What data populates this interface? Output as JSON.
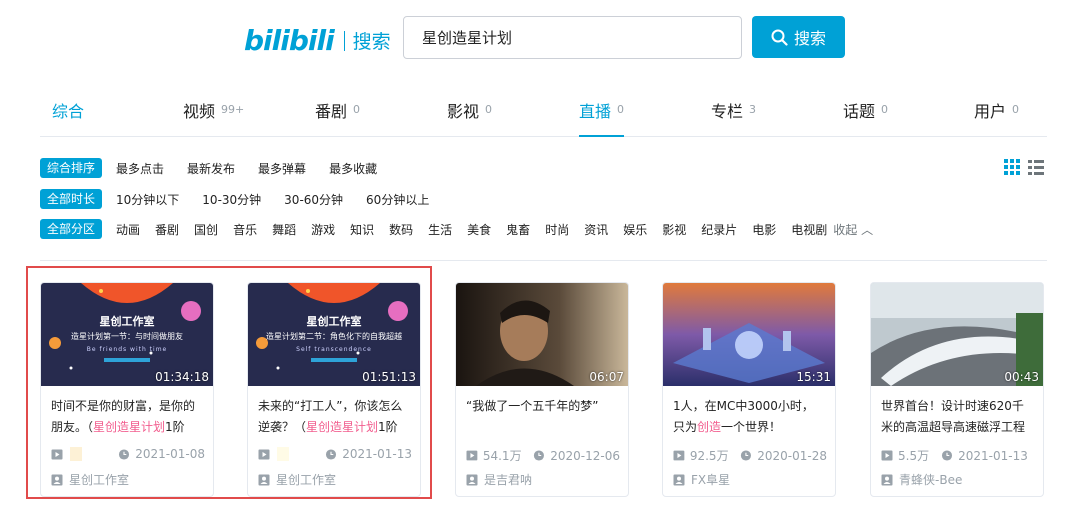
{
  "header": {
    "logo_text": "bilibili",
    "logo_sub": "搜索",
    "search_value": "星创造星计划",
    "search_button": "搜索"
  },
  "tabs": [
    {
      "label": "综合",
      "count": ""
    },
    {
      "label": "视频",
      "count": "99+"
    },
    {
      "label": "番剧",
      "count": "0"
    },
    {
      "label": "影视",
      "count": "0"
    },
    {
      "label": "直播",
      "count": "0"
    },
    {
      "label": "专栏",
      "count": "3"
    },
    {
      "label": "话题",
      "count": "0"
    },
    {
      "label": "用户",
      "count": "0"
    }
  ],
  "filters": {
    "order": {
      "badge": "综合排序",
      "options": [
        "最多点击",
        "最新发布",
        "最多弹幕",
        "最多收藏"
      ]
    },
    "duration": {
      "badge": "全部时长",
      "options": [
        "10分钟以下",
        "10-30分钟",
        "30-60分钟",
        "60分钟以上"
      ]
    },
    "zone": {
      "badge": "全部分区",
      "options": [
        "动画",
        "番剧",
        "国创",
        "音乐",
        "舞蹈",
        "游戏",
        "知识",
        "数码",
        "生活",
        "美食",
        "鬼畜",
        "时尚",
        "资讯",
        "娱乐",
        "影视",
        "纪录片",
        "电影",
        "电视剧"
      ],
      "collapse": "收起"
    }
  },
  "videos": [
    {
      "thumb_title": "星创工作室",
      "thumb_sub": "造星计划第一节：与时间做朋友",
      "thumb_en": "Be friends with time",
      "duration": "01:34:18",
      "title_a": "时间不是你的财富，是你的朋友。（",
      "title_hl": "星创造星计划",
      "title_b": "1阶",
      "plays": "",
      "date": "2021-01-08",
      "author": "星创工作室"
    },
    {
      "thumb_title": "星创工作室",
      "thumb_sub": "造星计划第二节：角色化下的自我超越",
      "thumb_en": "Self transcendence",
      "duration": "01:51:13",
      "title_a": "未来的“打工人”，你该怎么逆袭？（",
      "title_hl": "星创造星计划",
      "title_b": "1阶",
      "plays": "",
      "date": "2021-01-13",
      "author": "星创工作室"
    },
    {
      "duration": "06:07",
      "title_a": "“我做了一个五千年的梦”",
      "title_hl": "",
      "title_b": "",
      "plays": "54.1万",
      "date": "2020-12-06",
      "author": "是吉君呐"
    },
    {
      "duration": "15:31",
      "title_a": "1人，在MC中3000小时，只为",
      "title_hl": "创造",
      "title_b": "一个世界！",
      "plays": "92.5万",
      "date": "2020-01-28",
      "author": "FX阜星"
    },
    {
      "duration": "00:43",
      "title_a": "世界首台！设计时速620千米的高温超导高速磁浮工程",
      "title_hl": "",
      "title_b": "",
      "plays": "5.5万",
      "date": "2021-01-13",
      "author": "青蜂侠-Bee"
    }
  ],
  "colors": {
    "accent": "#00a1d6",
    "highlight_text": "#f25d8e",
    "selection_border": "#e14b4b"
  }
}
